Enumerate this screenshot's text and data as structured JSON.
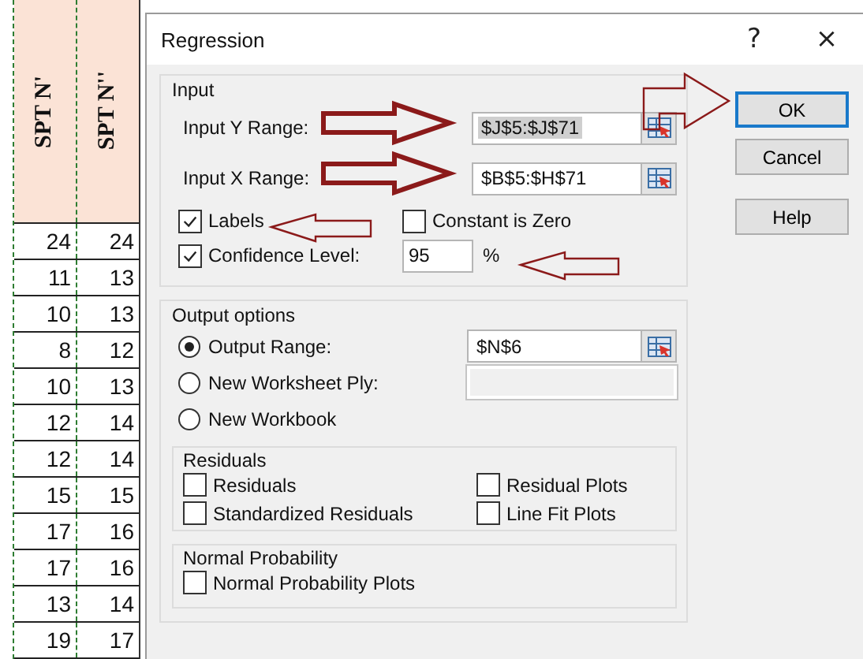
{
  "spreadsheet": {
    "columns": [
      "SPT N'",
      "SPT N''"
    ],
    "rows": [
      [
        "24",
        "24"
      ],
      [
        "11",
        "13"
      ],
      [
        "10",
        "13"
      ],
      [
        "8",
        "12"
      ],
      [
        "10",
        "13"
      ],
      [
        "12",
        "14"
      ],
      [
        "12",
        "14"
      ],
      [
        "15",
        "15"
      ],
      [
        "17",
        "16"
      ],
      [
        "17",
        "16"
      ],
      [
        "13",
        "14"
      ],
      [
        "19",
        "17"
      ]
    ]
  },
  "dialog": {
    "title": "Regression",
    "help_glyph": "?",
    "close_glyph": "×",
    "input": {
      "heading": "Input",
      "ranges": [
        {
          "label": "Input Y Range:",
          "value": "$J$5:$J$71",
          "highlighted": true
        },
        {
          "label": "Input X Range:",
          "value": "$B$5:$H$71",
          "highlighted": false
        }
      ],
      "labels": {
        "label": "Labels",
        "checked": true
      },
      "constant_zero": {
        "label": "Constant is Zero",
        "checked": false
      },
      "confidence": {
        "label": "Confidence Level:",
        "checked": true,
        "value": "95",
        "unit": "%"
      }
    },
    "output": {
      "heading": "Output options",
      "destinations": [
        {
          "label": "Output Range:",
          "selected": true,
          "value": "$N$6",
          "disabled": false
        },
        {
          "label": "New Worksheet Ply:",
          "selected": false,
          "disabled": true
        },
        {
          "label": "New Workbook",
          "selected": false
        }
      ],
      "residuals": {
        "heading": "Residuals",
        "options": [
          {
            "label": "Residuals",
            "checked": false
          },
          {
            "label": "Residual Plots",
            "checked": false
          },
          {
            "label": "Standardized Residuals",
            "checked": false
          },
          {
            "label": "Line Fit Plots",
            "checked": false
          }
        ]
      },
      "normal_probability": {
        "heading": "Normal Probability",
        "options": [
          {
            "label": "Normal Probability Plots",
            "checked": false
          }
        ]
      }
    },
    "buttons": [
      {
        "label": "OK",
        "default": true
      },
      {
        "label": "Cancel",
        "default": false
      },
      {
        "label": "Help",
        "default": false
      }
    ]
  }
}
